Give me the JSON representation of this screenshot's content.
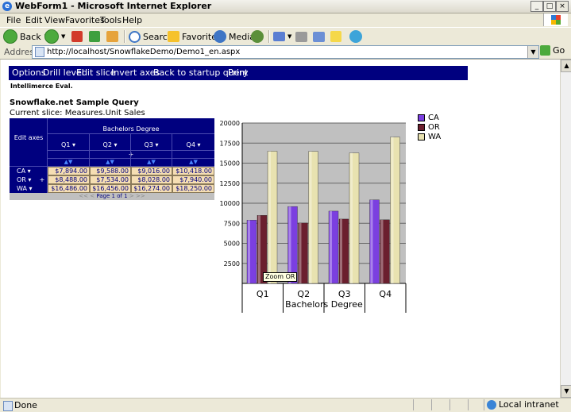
{
  "window": {
    "title": "WebForm1 - Microsoft Internet Explorer",
    "min_btn": "_",
    "max_btn": "□",
    "close_btn": "×"
  },
  "menu": [
    "File",
    "Edit",
    "View",
    "Favorites",
    "Tools",
    "Help"
  ],
  "toolbar": {
    "back": "Back",
    "search": "Search",
    "favorites": "Favorites",
    "media": "Media"
  },
  "address": {
    "label": "Address",
    "url": "http://localhost/SnowflakeDemo/Demo1_en.aspx",
    "go": "Go"
  },
  "status": {
    "text": "Done",
    "zone": "Local intranet"
  },
  "navbar": [
    "Options",
    "Drill level",
    "Edit slice",
    "Invert axes",
    "Back to startup query",
    "Print"
  ],
  "license": "Intellimerce Eval.",
  "query": {
    "title": "Snowflake.net Sample Query",
    "slice": "Current slice: Measures.Unit Sales"
  },
  "pivot": {
    "edit_axes": "Edit axes",
    "column_dimension": "Bachelors Degree",
    "plus": "+",
    "arrows": "▲▼",
    "columns": [
      "Q1 ▾",
      "Q2 ▾",
      "Q3 ▾",
      "Q4 ▾"
    ],
    "rows": [
      {
        "label": "CA ▾",
        "cells": [
          "$7,894.00",
          "$9,588.00",
          "$9,016.00",
          "$10,418.00"
        ]
      },
      {
        "label": "OR ▾",
        "cells": [
          "$8,488.00",
          "$7,534.00",
          "$8,028.00",
          "$7,940.00"
        ]
      },
      {
        "label": "WA ▾",
        "cells": [
          "$16,486.00",
          "$16,456.00",
          "$16,274.00",
          "$18,250.00"
        ]
      }
    ],
    "pager": {
      "prev": "<< <",
      "text": "Page 1 of 1",
      "next": "> >>"
    }
  },
  "chart_data": {
    "type": "bar",
    "categories": [
      "Q1",
      "Q2",
      "Q3",
      "Q4"
    ],
    "xlabel": "Bachelors Degree",
    "ylabel": "",
    "ylim": [
      0,
      20000
    ],
    "yticks": [
      2500,
      5000,
      7500,
      10000,
      12500,
      15000,
      17500,
      20000
    ],
    "grid": true,
    "legend_position": "right",
    "series": [
      {
        "name": "CA",
        "values": [
          7894,
          9588,
          9016,
          10418
        ],
        "color": "#7b3fe0"
      },
      {
        "name": "OR",
        "values": [
          8488,
          7534,
          8028,
          7940
        ],
        "color": "#6b1f2e"
      },
      {
        "name": "WA",
        "values": [
          16486,
          16456,
          16274,
          18250
        ],
        "color": "#e8e2b0"
      }
    ],
    "tooltip": "Zoom OR"
  }
}
